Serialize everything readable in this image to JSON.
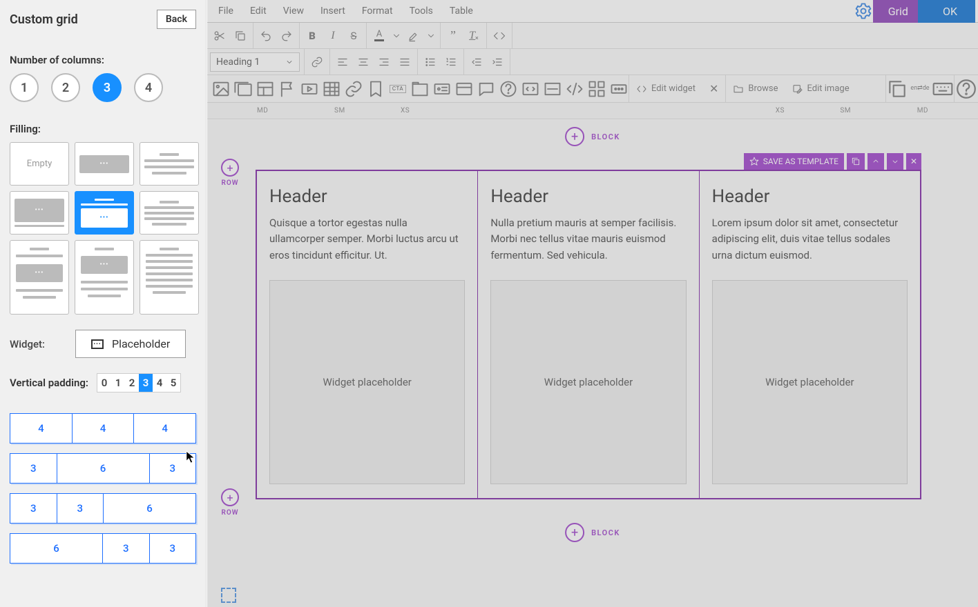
{
  "sidebar": {
    "title": "Custom grid",
    "back": "Back",
    "columns_label": "Number of columns:",
    "columns": [
      "1",
      "2",
      "3",
      "4"
    ],
    "columns_active_index": 2,
    "filling_label": "Filling:",
    "filling_empty": "Empty",
    "widget_label": "Widget:",
    "widget_value": "Placeholder",
    "vpad_label": "Vertical padding:",
    "vpad_options": [
      "0",
      "1",
      "2",
      "3",
      "4",
      "5"
    ],
    "vpad_active_index": 3,
    "grid_variants": [
      {
        "cells": [
          4,
          4,
          4
        ]
      },
      {
        "cells": [
          3,
          6,
          3
        ]
      },
      {
        "cells": [
          3,
          3,
          6
        ]
      },
      {
        "cells": [
          6,
          3,
          3
        ]
      }
    ]
  },
  "menubar": {
    "items": [
      "File",
      "Edit",
      "View",
      "Insert",
      "Format",
      "Tools",
      "Table"
    ],
    "grid": "Grid",
    "ok": "OK"
  },
  "toolbar": {
    "heading_select": "Heading 1",
    "edit_widget": "Edit widget",
    "browse": "Browse",
    "edit_image": "Edit image",
    "lang_badge": "en⇄de"
  },
  "ruler": {
    "md_left": "MD",
    "sm_left": "SM",
    "xs_left": "XS",
    "xs_right": "XS",
    "sm_right": "SM",
    "md_right": "MD"
  },
  "canvas": {
    "block_label": "BLOCK",
    "row_label": "ROW",
    "save_as_template": "SAVE AS TEMPLATE",
    "placeholder_text": "Widget placeholder",
    "columns": [
      {
        "header": "Header",
        "text": "Quisque a tortor egestas nulla ullamcorper semper. Morbi luctus arcu ut eros tincidunt efficitur. Ut."
      },
      {
        "header": "Header",
        "text": "Nulla pretium mauris at semper facilisis. Morbi nec tellus vitae mauris euismod fermentum. Sed vehicula."
      },
      {
        "header": "Header",
        "text": "Lorem ipsum dolor sit amet, consectetur adipiscing elit, duis vitae tellus sodales urna dictum euismod."
      }
    ]
  }
}
